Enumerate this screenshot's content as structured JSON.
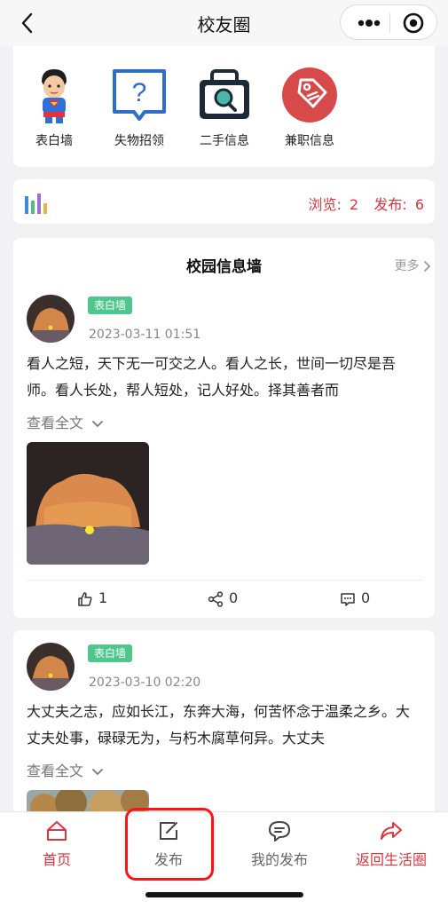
{
  "nav": {
    "title": "校友圈",
    "back_icon": "back-arrow-icon",
    "more_icon": "more-dots-icon",
    "close_icon": "target-close-icon"
  },
  "quick_links": [
    {
      "label": "表白墙",
      "icon": "superhero-icon"
    },
    {
      "label": "失物招领",
      "icon": "question-bubble-icon"
    },
    {
      "label": "二手信息",
      "icon": "bag-search-icon"
    },
    {
      "label": "兼职信息",
      "icon": "price-tag-icon"
    }
  ],
  "stats": {
    "views_label": "浏览:",
    "views": "2",
    "posts_label": "发布:",
    "posts": "6",
    "colors": {
      "accent": "#d9363e"
    }
  },
  "wall": {
    "title": "校园信息墙",
    "more": "更多"
  },
  "posts": [
    {
      "tag": "表白墙",
      "time": "2023-03-11 01:51",
      "content": "看人之短，天下无一可交之人。看人之长，世间一切尽是吾师。看人长处，帮人短处，记人好处。择其善者而",
      "expand": "查看全文",
      "likes": "1",
      "shares": "0",
      "comments": "0"
    },
    {
      "tag": "表白墙",
      "time": "2023-03-10 02:20",
      "content": "大丈夫之志，应如长江，东奔大海，何苦怀念于温柔之乡。大丈夫处事，碌碌无为，与朽木腐草何异。大丈夫",
      "expand": "查看全文"
    }
  ],
  "tabs": [
    {
      "label": "首页",
      "icon": "home-icon"
    },
    {
      "label": "发布",
      "icon": "edit-icon"
    },
    {
      "label": "我的发布",
      "icon": "chat-bubble-icon"
    },
    {
      "label": "返回生活圈",
      "icon": "share-arrow-icon"
    }
  ]
}
